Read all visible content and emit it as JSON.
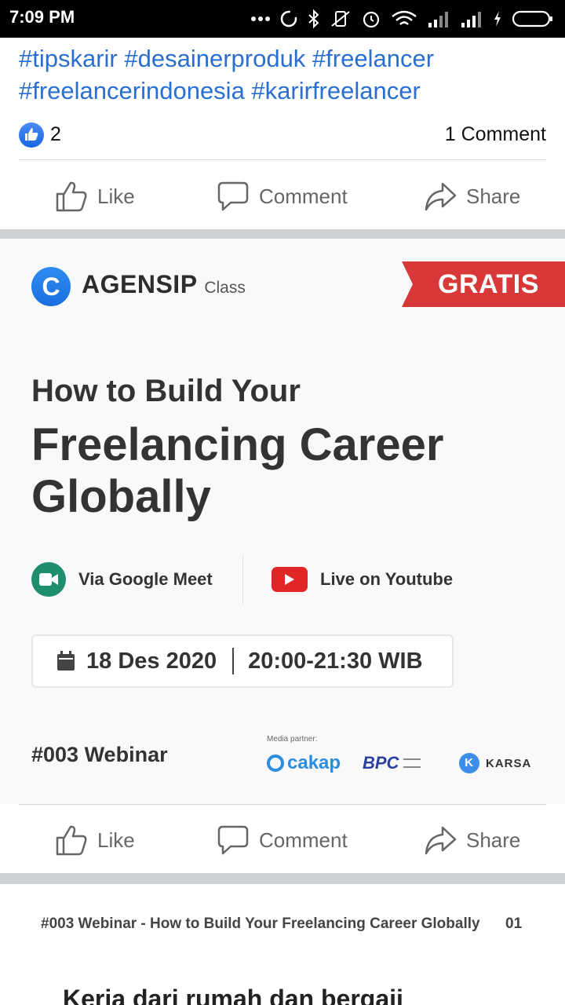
{
  "status_bar": {
    "time": "7:09 PM",
    "icons": [
      "more-icon",
      "sync-icon",
      "bluetooth-icon",
      "vibrate-off-icon",
      "alarm-icon",
      "wifi-icon",
      "signal-icon",
      "signal-icon",
      "charging-icon",
      "battery-icon"
    ]
  },
  "post1": {
    "hashtags_line1": "#tipskarir #desainerproduk #freelancer",
    "hashtags_line2": "#freelancerindonesia #karirfreelancer",
    "like_count": "2",
    "comment_count": "1 Comment",
    "actions": {
      "like": "Like",
      "comment": "Comment",
      "share": "Share"
    }
  },
  "poster": {
    "brand": "AGENSIP",
    "brand_sub": "Class",
    "logo_letter": "C",
    "badge": "GRATIS",
    "title_line1": "How to Build Your",
    "title_line2": "Freelancing Career Globally",
    "via_meet": "Via Google Meet",
    "live_youtube": "Live on Youtube",
    "date": "18 Des 2020",
    "time": "20:00-21:30 WIB",
    "webinar_no": "#003 Webinar",
    "media_partner_label": "Media partner:",
    "partners": {
      "cakap": "cakap",
      "bpc": "BPC",
      "karsa": "KARSA"
    },
    "colors": {
      "badge": "#d93838",
      "brand_blue": "#1a6fe0",
      "meet": "#1e8e6e",
      "youtube": "#e02626"
    }
  },
  "post2": {
    "actions": {
      "like": "Like",
      "comment": "Comment",
      "share": "Share"
    }
  },
  "post3": {
    "header": "#003 Webinar - How to Build Your Freelancing Career Globally",
    "page_num": "01",
    "title": "Kerja dari rumah dan bergaji"
  },
  "colors": {
    "hashtag": "#2a6fd0",
    "action_text": "#666666",
    "separator": "#cfd2d5"
  }
}
